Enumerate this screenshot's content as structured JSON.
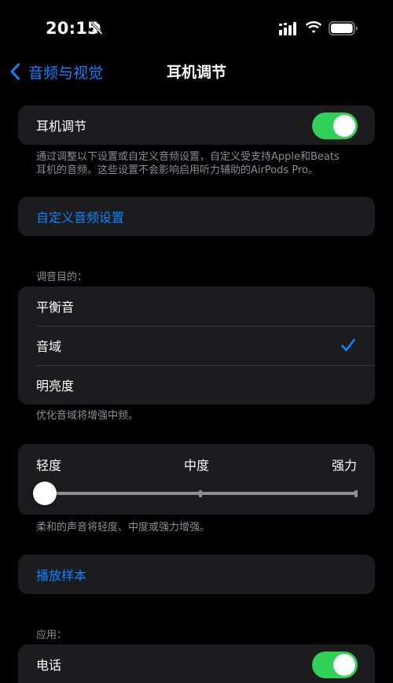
{
  "status": {
    "time": "20:15"
  },
  "nav": {
    "back_label": "音频与视觉",
    "title": "耳机调节"
  },
  "headphone": {
    "label": "耳机调节",
    "enabled": true,
    "footnote_line1": "通过调整以下设置或自定义音频设置，自定义受支持Apple和Beats",
    "footnote_line2": "耳机的音频。这些设置不会影响启用听力辅助的AirPods Pro。"
  },
  "custom_audio": {
    "label": "自定义音频设置"
  },
  "tune": {
    "header": "调音目的：",
    "options": [
      "平衡音",
      "音域",
      "明亮度"
    ],
    "selected": "音域",
    "footnote": "优化音域将增强中频。"
  },
  "strength": {
    "labels": [
      "轻度",
      "中度",
      "强力"
    ],
    "level": 0,
    "footnote": "柔和的声音将轻度、中度或强力增强。"
  },
  "sample": {
    "label": "播放样本"
  },
  "apply": {
    "header": "应用：",
    "phone_label": "电话",
    "phone_enabled": true
  },
  "colors": {
    "accent": "#0a84ff",
    "toggle_on": "#30d158",
    "cell": "#1c1c1e",
    "secondary_text": "#8e8e93"
  }
}
